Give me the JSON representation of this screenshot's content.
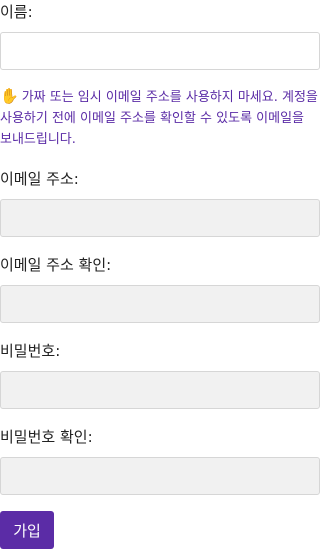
{
  "form": {
    "name_label": "이름:",
    "name_value": "",
    "notice_icon": "raised-hand-icon",
    "notice_text": "가짜 또는 임시 이메일 주소를 사용하지 마세요. 계정을 사용하기 전에 이메일 주소를 확인할 수 있도록 이메일을 보내드립니다.",
    "email_label": "이메일 주소:",
    "email_confirm_label": "이메일 주소 확인:",
    "password_label": "비밀번호:",
    "password_confirm_label": "비밀번호 확인:",
    "submit_label": "가입"
  },
  "colors": {
    "accent": "#5b2ca6",
    "field_background": "#f1f1f1",
    "field_border": "#d6d6d6"
  }
}
